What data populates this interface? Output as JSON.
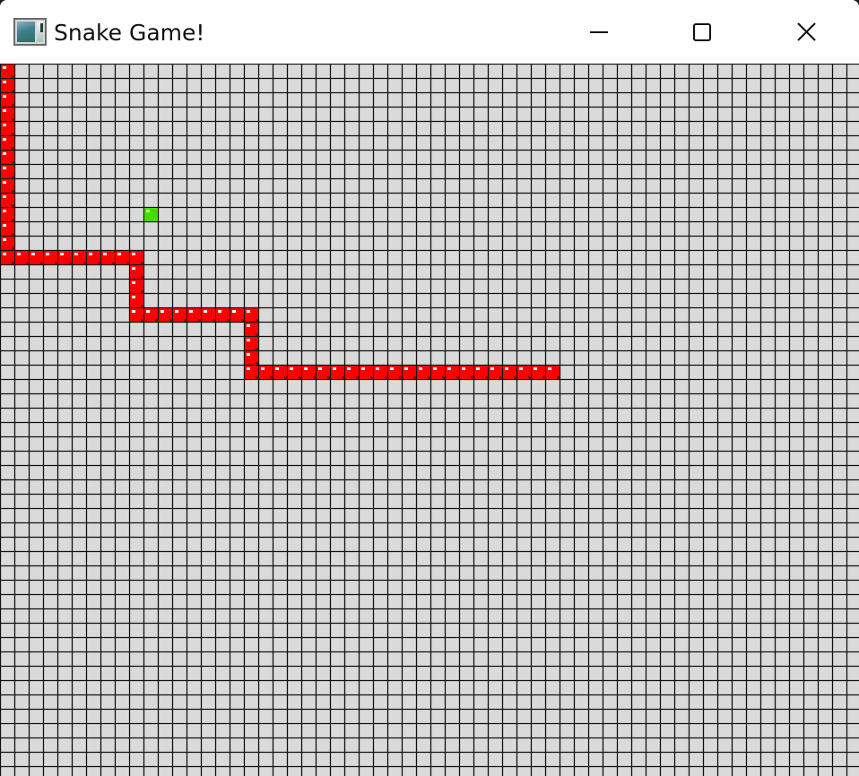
{
  "window": {
    "title": "Snake Game!",
    "controls": {
      "minimize_icon": "minimize-icon",
      "maximize_icon": "maximize-icon",
      "close_icon": "close-icon"
    }
  },
  "game": {
    "grid": {
      "columns": 60,
      "rows": 50
    },
    "colors": {
      "background": "#dadada",
      "grid": "#111111",
      "snake": "#ff0000",
      "snake_highlight": "#ffffff",
      "food": "#44dd00"
    },
    "snake": {
      "segments": [
        [
          0,
          0
        ],
        [
          0,
          1
        ],
        [
          0,
          2
        ],
        [
          0,
          3
        ],
        [
          0,
          4
        ],
        [
          0,
          5
        ],
        [
          0,
          6
        ],
        [
          0,
          7
        ],
        [
          0,
          8
        ],
        [
          0,
          9
        ],
        [
          0,
          10
        ],
        [
          0,
          11
        ],
        [
          0,
          12
        ],
        [
          0,
          13
        ],
        [
          1,
          13
        ],
        [
          2,
          13
        ],
        [
          3,
          13
        ],
        [
          4,
          13
        ],
        [
          5,
          13
        ],
        [
          6,
          13
        ],
        [
          7,
          13
        ],
        [
          8,
          13
        ],
        [
          9,
          13
        ],
        [
          9,
          14
        ],
        [
          9,
          15
        ],
        [
          9,
          16
        ],
        [
          9,
          17
        ],
        [
          10,
          17
        ],
        [
          11,
          17
        ],
        [
          12,
          17
        ],
        [
          13,
          17
        ],
        [
          14,
          17
        ],
        [
          15,
          17
        ],
        [
          16,
          17
        ],
        [
          17,
          17
        ],
        [
          17,
          18
        ],
        [
          17,
          19
        ],
        [
          17,
          20
        ],
        [
          17,
          21
        ],
        [
          18,
          21
        ],
        [
          19,
          21
        ],
        [
          20,
          21
        ],
        [
          21,
          21
        ],
        [
          22,
          21
        ],
        [
          23,
          21
        ],
        [
          24,
          21
        ],
        [
          25,
          21
        ],
        [
          26,
          21
        ],
        [
          27,
          21
        ],
        [
          28,
          21
        ],
        [
          29,
          21
        ],
        [
          30,
          21
        ],
        [
          31,
          21
        ],
        [
          32,
          21
        ],
        [
          33,
          21
        ],
        [
          34,
          21
        ],
        [
          35,
          21
        ],
        [
          36,
          21
        ],
        [
          37,
          21
        ],
        [
          38,
          21
        ]
      ]
    },
    "food": {
      "cell": [
        10,
        10
      ]
    }
  }
}
